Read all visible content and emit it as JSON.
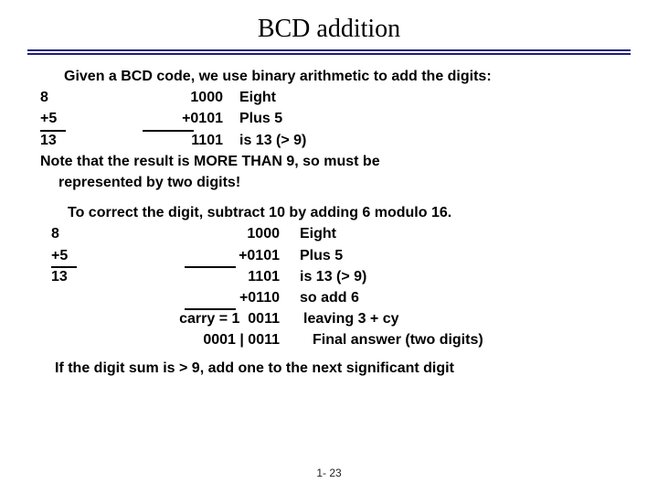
{
  "title": "BCD addition",
  "intro1": "Given a BCD code, we use binary arithmetic to add the digits:",
  "block1": {
    "r1": {
      "dec": "8",
      "bin": "1000",
      "desc": "Eight"
    },
    "r2": {
      "dec": "+5",
      "bin": "+0101",
      "desc": "Plus 5"
    },
    "r3": {
      "dec": "13",
      "bin": "1101",
      "desc": "is 13 (> 9)"
    }
  },
  "note1a": "Note that the result is MORE THAN 9, so must be",
  "note1b": "represented by two digits!",
  "intro2": "To correct the digit, subtract 10 by adding 6 modulo 16.",
  "block2": {
    "r1": {
      "dec": "8",
      "bin": "1000",
      "desc": "Eight"
    },
    "r2": {
      "dec": "+5",
      "bin": "+0101",
      "desc": "Plus 5"
    },
    "r3": {
      "dec": "13",
      "bin": "1101",
      "desc": "is 13 (> 9)"
    },
    "r4": {
      "dec": "",
      "bin": "+0110",
      "desc": "so add 6"
    },
    "r5": {
      "dec": "",
      "bin": "carry = 1  0011",
      "desc": "leaving 3 + cy"
    },
    "r6": {
      "dec": "",
      "bin": "0001 | 0011",
      "desc": "Final answer (two digits)"
    }
  },
  "closing": "If the digit sum is > 9, add one to the next significant digit",
  "footer": "1- 23"
}
